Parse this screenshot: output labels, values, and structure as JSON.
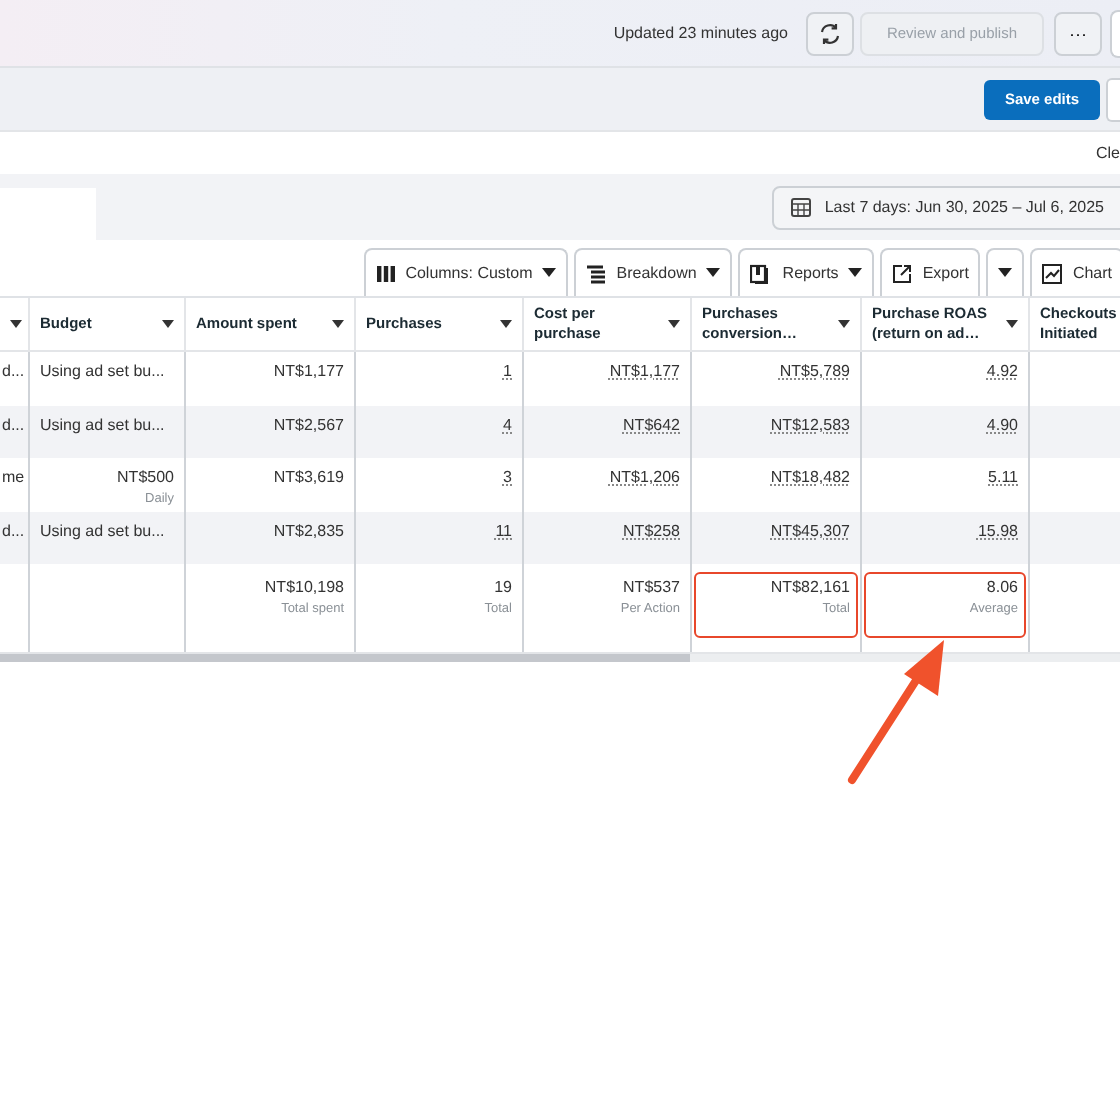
{
  "top_bar": {
    "updated": "Updated 23 minutes ago",
    "review_button": "Review and publish",
    "more_button": "···"
  },
  "edit_bar": {
    "save_button": "Save edits"
  },
  "filter_bar": {
    "clear_link": "Cle"
  },
  "date_range": {
    "label": "Last 7 days: Jun 30, 2025 – Jul 6, 2025"
  },
  "toolbar": [
    {
      "kind": "columns",
      "label": "Columns: Custom",
      "dropdown": true
    },
    {
      "kind": "breakdown",
      "label": "Breakdown",
      "dropdown": true
    },
    {
      "kind": "reports",
      "label": "Reports",
      "dropdown": true
    },
    {
      "kind": "export",
      "label": "Export",
      "dropdown": false
    },
    {
      "kind": "caret",
      "dropdown": true
    },
    {
      "kind": "chart",
      "label": "Chart",
      "dropdown": false
    }
  ],
  "table": {
    "columns": [
      {
        "sortable": true
      },
      {
        "label": "Budget",
        "sortable": true
      },
      {
        "label": "Amount spent",
        "sortable": true
      },
      {
        "label": "Purchases",
        "sortable": true
      },
      {
        "label": "Cost per\npurchase",
        "sortable": true
      },
      {
        "label": "Purchases\nconversion…",
        "sortable": true
      },
      {
        "label": "Purchase ROAS\n(return on ad…",
        "sortable": true
      },
      {
        "label": "Checkouts\nInitiated",
        "sortable": false
      }
    ],
    "rows": [
      {
        "cells": [
          {
            "kind": "text",
            "value": "d..."
          },
          {
            "kind": "text",
            "value": "Using ad set bu..."
          },
          {
            "kind": "amount",
            "value": "NT$1,177"
          },
          {
            "kind": "metric",
            "value": "1"
          },
          {
            "kind": "metric",
            "value": "NT$1,177"
          },
          {
            "kind": "metric",
            "value": "NT$5,789"
          },
          {
            "kind": "metric",
            "value": "4.92"
          }
        ]
      },
      {
        "cells": [
          {
            "kind": "text",
            "value": "d..."
          },
          {
            "kind": "text",
            "value": "Using ad set bu..."
          },
          {
            "kind": "amount",
            "value": "NT$2,567"
          },
          {
            "kind": "metric",
            "value": "4"
          },
          {
            "kind": "metric",
            "value": "NT$642"
          },
          {
            "kind": "metric",
            "value": "NT$12,583"
          },
          {
            "kind": "metric",
            "value": "4.90"
          }
        ]
      },
      {
        "cells": [
          {
            "kind": "text",
            "value": "me"
          },
          {
            "kind": "amount",
            "value": "NT$500",
            "sub": "Daily"
          },
          {
            "kind": "amount",
            "value": "NT$3,619"
          },
          {
            "kind": "metric",
            "value": "3"
          },
          {
            "kind": "metric",
            "value": "NT$1,206"
          },
          {
            "kind": "metric",
            "value": "NT$18,482"
          },
          {
            "kind": "metric",
            "value": "5.11"
          }
        ]
      },
      {
        "cells": [
          {
            "kind": "text",
            "value": "d..."
          },
          {
            "kind": "text",
            "value": "Using ad set bu..."
          },
          {
            "kind": "amount",
            "value": "NT$2,835"
          },
          {
            "kind": "metric",
            "value": "11"
          },
          {
            "kind": "metric",
            "value": "NT$258"
          },
          {
            "kind": "metric",
            "value": "NT$45,307"
          },
          {
            "kind": "metric",
            "value": "15.98"
          }
        ]
      }
    ],
    "totals": [
      {
        "value": "NT$10,198",
        "note": "Total spent",
        "highlighted": false
      },
      {
        "value": "19",
        "note": "Total",
        "highlighted": false
      },
      {
        "value": "NT$537",
        "note": "Per Action",
        "highlighted": false
      },
      {
        "value": "NT$82,161",
        "note": "Total",
        "highlighted": true
      },
      {
        "value": "8.06",
        "note": "Average",
        "highlighted": true
      }
    ]
  },
  "annotation": {
    "arrow": true
  }
}
